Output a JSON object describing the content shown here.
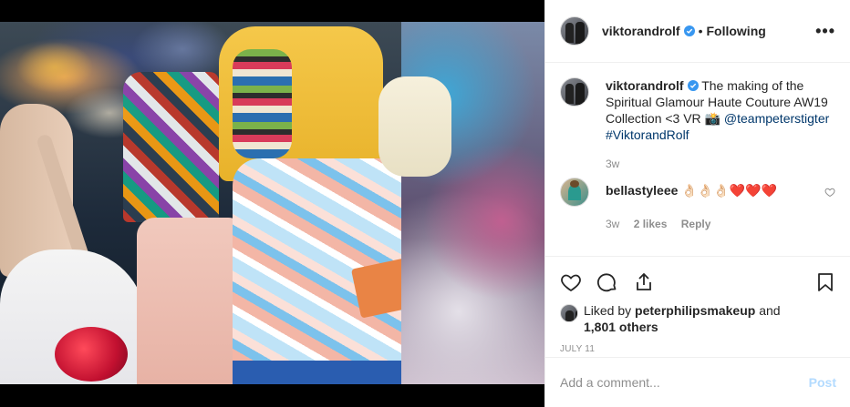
{
  "post": {
    "username": "viktorandrolf",
    "follow_status": "Following",
    "separator": "•",
    "more_label": "•••"
  },
  "caption": {
    "username": "viktorandrolf",
    "text": "The making of the Spiritual Glamour Haute Couture AW19 Collection <3 VR 📸",
    "mention": "@teampeterstigter",
    "hashtag": "#ViktorandRolf",
    "time": "3w"
  },
  "comment": {
    "username": "bellastyleee",
    "text": "👌🏻👌🏻👌🏻❤️❤️❤️",
    "time": "3w",
    "likes": "2 likes",
    "reply_label": "Reply"
  },
  "likes": {
    "prefix": "Liked by",
    "user": "peterphilipsmakeup",
    "middle": "and",
    "others": "1,801 others"
  },
  "date": "JULY 11",
  "composer": {
    "placeholder": "Add a comment...",
    "post_label": "Post"
  },
  "icons": {
    "like": "heart-icon",
    "comment": "comment-icon",
    "share": "share-icon",
    "save": "bookmark-icon",
    "verified": "verified-badge-icon"
  },
  "colors": {
    "verified": "#3897f0",
    "link": "#00376b",
    "muted": "#8e8e8e",
    "post_disabled": "#b3dbff"
  }
}
